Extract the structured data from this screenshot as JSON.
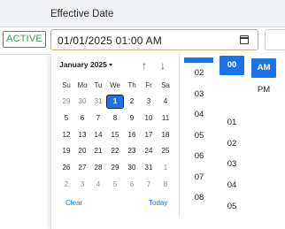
{
  "header": {
    "column_label": "Effective Date"
  },
  "row": {
    "status": "ACTIVE",
    "datetime_value": "01/01/2025 01:00 AM"
  },
  "picker": {
    "month_label": "January 2025",
    "weekdays": [
      "Su",
      "Mo",
      "Tu",
      "We",
      "Th",
      "Fr",
      "Sa"
    ],
    "weeks": [
      [
        "29",
        "30",
        "31",
        "1",
        "2",
        "3",
        "4"
      ],
      [
        "5",
        "6",
        "7",
        "8",
        "9",
        "10",
        "11"
      ],
      [
        "12",
        "13",
        "14",
        "15",
        "16",
        "17",
        "18"
      ],
      [
        "19",
        "20",
        "21",
        "22",
        "23",
        "24",
        "25"
      ],
      [
        "26",
        "27",
        "28",
        "29",
        "30",
        "31",
        "1"
      ],
      [
        "2",
        "3",
        "4",
        "5",
        "6",
        "7",
        "8"
      ]
    ],
    "selected_day": "1",
    "clear_label": "Clear",
    "today_label": "Today",
    "hours": [
      "02",
      "03",
      "04",
      "05",
      "06",
      "07",
      "08"
    ],
    "minutes_selected": "00",
    "minutes": [
      "01",
      "02",
      "03",
      "04",
      "05"
    ],
    "ampm_selected": "AM",
    "ampm_other": "PM",
    "accent_color": "#1a73e8",
    "status_color": "#2e9d5a"
  }
}
